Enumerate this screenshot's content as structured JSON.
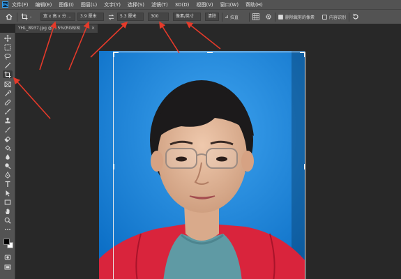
{
  "app": {
    "logo_text": "Ps"
  },
  "menu": {
    "items": [
      "文件(F)",
      "编辑(E)",
      "图像(I)",
      "图层(L)",
      "文字(Y)",
      "选择(S)",
      "滤镜(T)",
      "3D(D)",
      "视图(V)",
      "窗口(W)",
      "帮助(H)"
    ]
  },
  "options": {
    "ratio_preset": "宽 x 高 x 分 ...",
    "width_value": "3.9 厘米",
    "height_value": "5.3 厘米",
    "resolution_value": "300",
    "resolution_unit": "像素/英寸",
    "clear_label": "清除",
    "straighten_label": "拉直",
    "delete_cropped_label": "删除裁剪的像素",
    "delete_cropped_checked": true,
    "content_aware_label": "内容识别",
    "content_aware_checked": false
  },
  "document": {
    "tab_title": "YHL_8937.jpg @ ...5%(RGB/8)"
  },
  "colors": {
    "accent_arrow": "#e53a2a",
    "photo_background": "#1a86d9",
    "jacket": "#d9243c"
  }
}
